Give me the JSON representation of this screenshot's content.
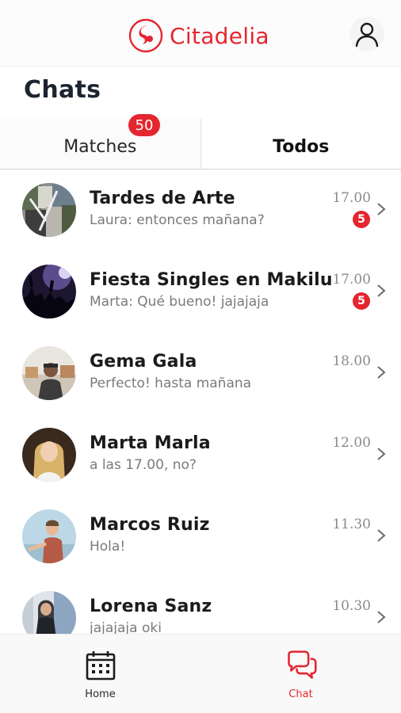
{
  "header": {
    "brand": "Citadelia",
    "brand_color": "#e4262f",
    "profile_icon": "user-icon"
  },
  "page_title": "Chats",
  "tabs": [
    {
      "label": "Matches",
      "badge": "50",
      "active": false
    },
    {
      "label": "Todos",
      "active": true
    }
  ],
  "chats": [
    {
      "name": "Tardes de Arte",
      "preview": "Laura: entonces mañana?",
      "time": "17.00",
      "unread": "5"
    },
    {
      "name": "Fiesta Singles en Makilu",
      "preview": "Marta: Qué bueno! jajajaja",
      "time": "17.00",
      "unread": "5"
    },
    {
      "name": "Gema Gala",
      "preview": "Perfecto! hasta mañana",
      "time": "18.00"
    },
    {
      "name": "Marta Marla",
      "preview": "a las 17.00, no?",
      "time": "12.00"
    },
    {
      "name": "Marcos Ruiz",
      "preview": "Hola!",
      "time": "11.30"
    },
    {
      "name": "Lorena Sanz",
      "preview": "jajajaja oki",
      "time": "10.30"
    }
  ],
  "bottom_nav": [
    {
      "label": "Home",
      "icon": "calendar-icon",
      "active": false
    },
    {
      "label": "Chat",
      "icon": "chat-bubbles-icon",
      "active": true
    }
  ]
}
